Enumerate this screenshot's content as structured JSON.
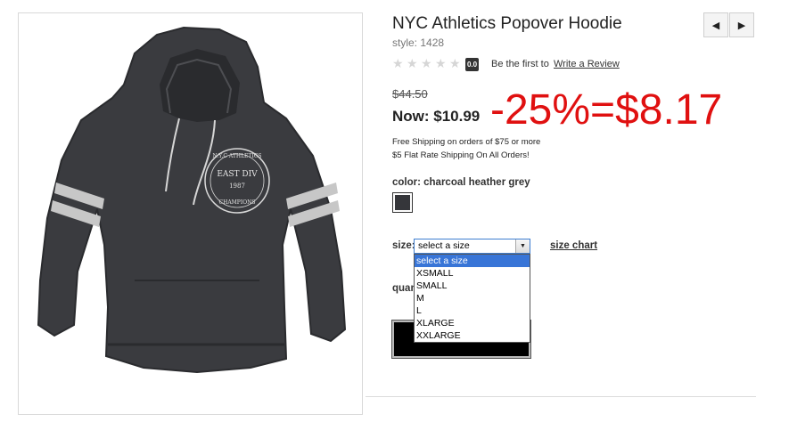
{
  "product": {
    "title": "NYC Athletics Popover Hoodie",
    "style": "style: 1428",
    "graphic_text": {
      "line1": "N.Y.C ATHLETICS",
      "line2": "EAST DIV",
      "line3": "1987",
      "line4": "CHAMPIONS"
    }
  },
  "nav": {
    "prev_icon": "triangle-left",
    "next_icon": "triangle-right"
  },
  "rating": {
    "stars": [
      "★",
      "★",
      "★",
      "★",
      "★"
    ],
    "score": "0.0",
    "prompt": "Be the first to",
    "link": "Write a Review"
  },
  "price": {
    "original": "$44.50",
    "now": "Now: $10.99",
    "annotation": "-25%=$8.17"
  },
  "shipping": {
    "line1": "Free Shipping on orders of $75 or more",
    "line2": "$5 Flat Rate Shipping On All Orders!"
  },
  "color": {
    "label": "color: charcoal heather grey",
    "swatch": "#35363a"
  },
  "size": {
    "label": "size:",
    "selected": "select a size",
    "options": [
      "select a size",
      "XSMALL",
      "SMALL",
      "M",
      "L",
      "XLARGE",
      "XXLARGE"
    ],
    "chart_link": "size chart"
  },
  "quantity": {
    "label": "quan"
  },
  "colors": {
    "annotation_red": "#e01010",
    "option_highlight": "#3875d7",
    "hoodie": "#3a3b3f"
  }
}
